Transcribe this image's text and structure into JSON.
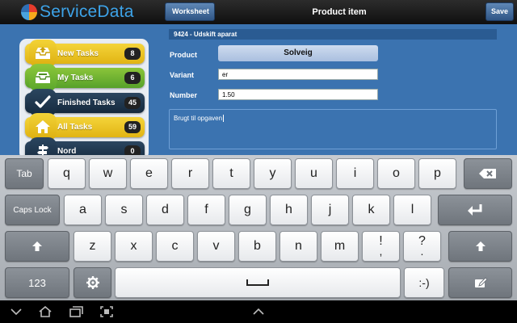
{
  "app": {
    "logo_text": "ServiceData"
  },
  "topbar": {
    "back_label": "Worksheet",
    "title": "Product item",
    "save_label": "Save"
  },
  "sidebar": {
    "items": [
      {
        "label": "New Tasks",
        "count": "8",
        "icon": "inbox-upload-icon",
        "color": "yellow"
      },
      {
        "label": "My Tasks",
        "count": "6",
        "icon": "inbox-tray-icon",
        "color": "green"
      },
      {
        "label": "Finished Tasks",
        "count": "45",
        "icon": "checkmark-icon",
        "color": "navy"
      },
      {
        "label": "All Tasks",
        "count": "59",
        "icon": "home-icon",
        "color": "yellow"
      },
      {
        "label": "Nord",
        "count": "0",
        "icon": "signpost-icon",
        "color": "navy"
      }
    ]
  },
  "form": {
    "header": "9424 - Udskift aparat",
    "product_label": "Product",
    "product_value": "Solveig",
    "variant_label": "Variant",
    "variant_value": "er",
    "number_label": "Number",
    "number_value": "1.50",
    "notes_value": "Brugt til opgaven"
  },
  "keyboard": {
    "row1": [
      "q",
      "w",
      "e",
      "r",
      "t",
      "y",
      "u",
      "i",
      "o",
      "p"
    ],
    "row2": [
      "a",
      "s",
      "d",
      "f",
      "g",
      "h",
      "j",
      "k",
      "l"
    ],
    "row3": [
      "z",
      "x",
      "c",
      "v",
      "b",
      "n",
      "m",
      "!",
      "?"
    ],
    "row3_sub": [
      ",",
      "."
    ],
    "tab_label": "Tab",
    "caps_label": "Caps Lock",
    "num_label": "123",
    "smiley_label": ":-)"
  },
  "colors": {
    "panel_blue": "#3b73b0",
    "header_blue": "#2a5b92",
    "accent_yellow": "#e9c21f",
    "accent_green": "#6fb531",
    "navy": "#1d344c"
  }
}
